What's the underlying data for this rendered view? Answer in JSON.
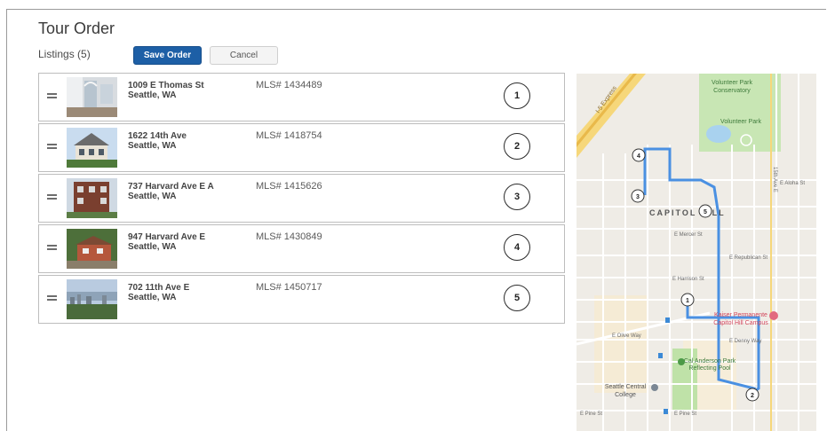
{
  "page": {
    "title": "Tour Order",
    "listings_label": "Listings (5)",
    "save_label": "Save Order",
    "cancel_label": "Cancel"
  },
  "listings": [
    {
      "order": "1",
      "line1": "1009 E Thomas St",
      "line2": "Seattle, WA",
      "mls": "MLS# 1434489"
    },
    {
      "order": "2",
      "line1": "1622 14th Ave",
      "line2": "Seattle, WA",
      "mls": "MLS# 1418754"
    },
    {
      "order": "3",
      "line1": "737 Harvard Ave E A",
      "line2": "Seattle, WA",
      "mls": "MLS# 1415626"
    },
    {
      "order": "4",
      "line1": "947 Harvard Ave E",
      "line2": "Seattle, WA",
      "mls": "MLS# 1430849"
    },
    {
      "order": "5",
      "line1": "702 11th Ave E",
      "line2": "Seattle, WA",
      "mls": "MLS# 1450717"
    }
  ],
  "map": {
    "neighborhood": "CAPITOL HILL",
    "places": {
      "volunteer_conservatory_1": "Volunteer Park",
      "volunteer_conservatory_2": "Conservatory",
      "volunteer_park": "Volunteer Park",
      "kaiser_1": "Kaiser Permanente",
      "kaiser_2": "Capitol Hill Campus",
      "cal_anderson_1": "Cal Anderson Park",
      "cal_anderson_2": "Reflecting Pool",
      "seattle_central_1": "Seattle Central",
      "seattle_central_2": "College"
    },
    "streets": {
      "i5": "I-5 Express",
      "aloha": "E Aloha St",
      "olive": "E Olive Way",
      "denny": "E Denny Way",
      "pine": "E Pine St",
      "pine_left": "E Pine St",
      "ave15": "15th Ave E",
      "mercer": "E Mercer St",
      "republican": "E Republican St",
      "harrison": "E Harrison St"
    },
    "route_color": "#4a90e2",
    "markers": [
      "1",
      "2",
      "3",
      "4",
      "5"
    ]
  }
}
